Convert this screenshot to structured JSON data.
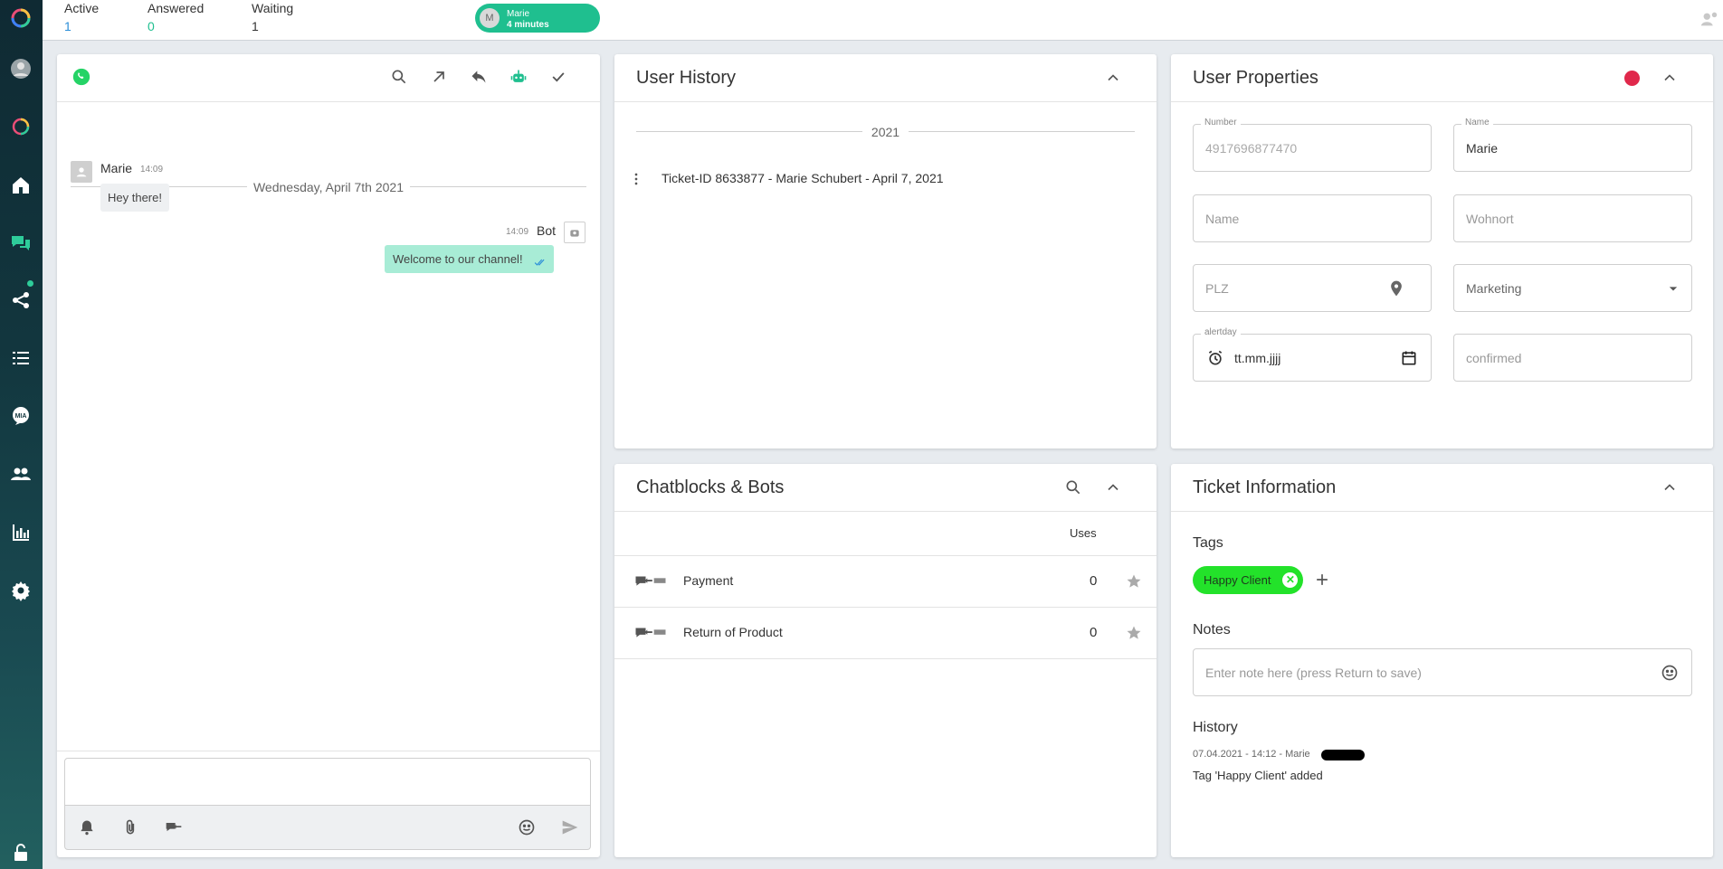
{
  "topbar": {
    "active_label": "Active",
    "active_value": "1",
    "answered_label": "Answered",
    "answered_value": "0",
    "waiting_label": "Waiting",
    "waiting_value": "1",
    "agent_initial": "M",
    "agent_name": "Marie",
    "agent_time": "4 minutes"
  },
  "chat": {
    "date": "Wednesday, April 7th 2021",
    "messages": [
      {
        "sender": "Marie",
        "time": "14:09",
        "text": "Hey there!"
      },
      {
        "sender": "Bot",
        "time": "14:09",
        "text": "Welcome to our channel!"
      }
    ]
  },
  "user_history": {
    "title": "User History",
    "year": "2021",
    "entries": [
      {
        "text": "Ticket-ID 8633877 - Marie Schubert - April 7, 2021"
      }
    ]
  },
  "user_properties": {
    "title": "User Properties",
    "number_label": "Number",
    "number_value": "4917696877470",
    "name_label": "Name",
    "name_value": "Marie",
    "name2_placeholder": "Name",
    "wohnort_placeholder": "Wohnort",
    "plz_placeholder": "PLZ",
    "marketing_value": "Marketing",
    "alertday_label": "alertday",
    "alertday_value": "tt.mm.jjjj",
    "confirmed_placeholder": "confirmed",
    "status_color": "#e0284b"
  },
  "chatblocks": {
    "title": "Chatblocks & Bots",
    "uses_label": "Uses",
    "rows": [
      {
        "name": "Payment",
        "uses": "0"
      },
      {
        "name": "Return of Product",
        "uses": "0"
      }
    ]
  },
  "ticket": {
    "title": "Ticket Information",
    "tags_label": "Tags",
    "tag": "Happy Client",
    "tag_color": "#23e22a",
    "notes_label": "Notes",
    "notes_placeholder": "Enter note here (press Return to save)",
    "history_label": "History",
    "history_meta": "07.04.2021 - 14:12 - Marie",
    "history_text": "Tag 'Happy Client' added"
  },
  "colors": {
    "accent": "#1fbf8f",
    "bubble_bot": "#a8ecd6",
    "bubble_user": "#eef0f2"
  }
}
